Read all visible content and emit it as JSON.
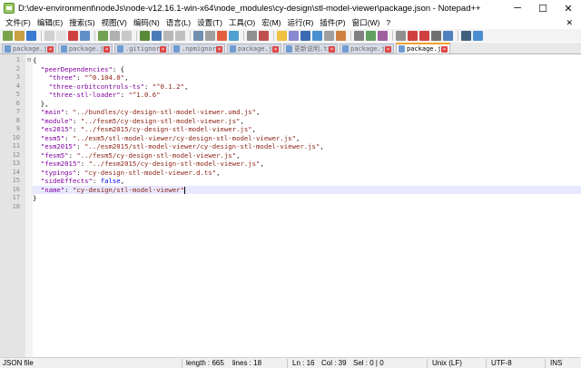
{
  "window": {
    "title": "D:\\dev-environment\\nodeJs\\node-v12.16.1-win-x64\\node_modules\\cy-design\\stl-model-viewer\\package.json - Notepad++",
    "minimize": "─",
    "maximize": "☐",
    "close": "✕"
  },
  "menu": [
    "文件(F)",
    "编辑(E)",
    "搜索(S)",
    "视图(V)",
    "编码(N)",
    "语言(L)",
    "设置(T)",
    "工具(O)",
    "宏(M)",
    "运行(R)",
    "插件(P)",
    "窗口(W)",
    "?"
  ],
  "menu_close": "✕",
  "toolbar": {
    "colors": [
      "#7ba44a",
      "#c9a042",
      "#3a7ad0",
      "#d0d0d0",
      "#e2e2e2",
      "#d04040",
      "#6090c8",
      "#70a050",
      "#b0b0b0",
      "#c8c8c8",
      "#5a8a3a",
      "#4a7ab8",
      "#b8b8b8",
      "#c0c0c0",
      "#7090b0",
      "#a0a0a0",
      "#e06040",
      "#50a0d0",
      "#909090",
      "#c05050",
      "#f0c040",
      "#8888d0",
      "#3a6ab0",
      "#4a90d0",
      "#a0a0a0",
      "#d08040",
      "#808080",
      "#60a060",
      "#a060a0",
      "#909090",
      "#d04040",
      "#d04040",
      "#707070",
      "#5080c0",
      "#406080",
      "#4a90d0"
    ],
    "groups": [
      3,
      4,
      3,
      4,
      4,
      2,
      6,
      3,
      5,
      2
    ]
  },
  "tabs": [
    {
      "label": "package.json",
      "active": false
    },
    {
      "label": "package.json",
      "active": false
    },
    {
      "label": ".gitignore",
      "active": false
    },
    {
      "label": ".npmignore",
      "active": false
    },
    {
      "label": "package.json",
      "active": false
    },
    {
      "label": "更新说明.txt",
      "active": false
    },
    {
      "label": "package.json",
      "active": false
    },
    {
      "label": "package.json",
      "active": true
    }
  ],
  "editor": {
    "current_line": 16,
    "lines": [
      {
        "n": "1",
        "fold": "⊟",
        "tokens": [
          {
            "t": "{",
            "c": "p"
          }
        ]
      },
      {
        "n": "2",
        "fold": "",
        "tokens": [
          {
            "t": "  ",
            "c": "p"
          },
          {
            "t": "\"peerDependencies\"",
            "c": "k"
          },
          {
            "t": ": {",
            "c": "p"
          }
        ]
      },
      {
        "n": "3",
        "fold": "",
        "tokens": [
          {
            "t": "    ",
            "c": "p"
          },
          {
            "t": "\"three\"",
            "c": "k"
          },
          {
            "t": ": ",
            "c": "p"
          },
          {
            "t": "\"^0.104.0\"",
            "c": "s"
          },
          {
            "t": ",",
            "c": "p"
          }
        ]
      },
      {
        "n": "4",
        "fold": "",
        "tokens": [
          {
            "t": "    ",
            "c": "p"
          },
          {
            "t": "\"three-orbitcontrols-ts\"",
            "c": "k"
          },
          {
            "t": ": ",
            "c": "p"
          },
          {
            "t": "\"^0.1.2\"",
            "c": "s"
          },
          {
            "t": ",",
            "c": "p"
          }
        ]
      },
      {
        "n": "5",
        "fold": "",
        "tokens": [
          {
            "t": "    ",
            "c": "p"
          },
          {
            "t": "\"three-stl-loader\"",
            "c": "k"
          },
          {
            "t": ": ",
            "c": "p"
          },
          {
            "t": "\"^1.0.6\"",
            "c": "s"
          }
        ]
      },
      {
        "n": "6",
        "fold": "",
        "tokens": [
          {
            "t": "  },",
            "c": "p"
          }
        ]
      },
      {
        "n": "7",
        "fold": "",
        "tokens": [
          {
            "t": "  ",
            "c": "p"
          },
          {
            "t": "\"main\"",
            "c": "k"
          },
          {
            "t": ": ",
            "c": "p"
          },
          {
            "t": "\"../bundles/cy-design-stl-model-viewer.umd.js\"",
            "c": "s"
          },
          {
            "t": ",",
            "c": "p"
          }
        ]
      },
      {
        "n": "8",
        "fold": "",
        "tokens": [
          {
            "t": "  ",
            "c": "p"
          },
          {
            "t": "\"module\"",
            "c": "k"
          },
          {
            "t": ": ",
            "c": "p"
          },
          {
            "t": "\"../fesm5/cy-design-stl-model-viewer.js\"",
            "c": "s"
          },
          {
            "t": ",",
            "c": "p"
          }
        ]
      },
      {
        "n": "9",
        "fold": "",
        "tokens": [
          {
            "t": "  ",
            "c": "p"
          },
          {
            "t": "\"es2015\"",
            "c": "k"
          },
          {
            "t": ": ",
            "c": "p"
          },
          {
            "t": "\"../fesm2015/cy-design-stl-model-viewer.js\"",
            "c": "s"
          },
          {
            "t": ",",
            "c": "p"
          }
        ]
      },
      {
        "n": "10",
        "fold": "",
        "tokens": [
          {
            "t": "  ",
            "c": "p"
          },
          {
            "t": "\"esm5\"",
            "c": "k"
          },
          {
            "t": ": ",
            "c": "p"
          },
          {
            "t": "\"../esm5/stl-model-viewer/cy-design-stl-model-viewer.js\"",
            "c": "s"
          },
          {
            "t": ",",
            "c": "p"
          }
        ]
      },
      {
        "n": "11",
        "fold": "",
        "tokens": [
          {
            "t": "  ",
            "c": "p"
          },
          {
            "t": "\"esm2015\"",
            "c": "k"
          },
          {
            "t": ": ",
            "c": "p"
          },
          {
            "t": "\"../esm2015/stl-model-viewer/cy-design-stl-model-viewer.js\"",
            "c": "s"
          },
          {
            "t": ",",
            "c": "p"
          }
        ]
      },
      {
        "n": "12",
        "fold": "",
        "tokens": [
          {
            "t": "  ",
            "c": "p"
          },
          {
            "t": "\"fesm5\"",
            "c": "k"
          },
          {
            "t": ": ",
            "c": "p"
          },
          {
            "t": "\"../fesm5/cy-design-stl-model-viewer.js\"",
            "c": "s"
          },
          {
            "t": ",",
            "c": "p"
          }
        ]
      },
      {
        "n": "13",
        "fold": "",
        "tokens": [
          {
            "t": "  ",
            "c": "p"
          },
          {
            "t": "\"fesm2015\"",
            "c": "k"
          },
          {
            "t": ": ",
            "c": "p"
          },
          {
            "t": "\"../fesm2015/cy-design-stl-model-viewer.js\"",
            "c": "s"
          },
          {
            "t": ",",
            "c": "p"
          }
        ]
      },
      {
        "n": "14",
        "fold": "",
        "tokens": [
          {
            "t": "  ",
            "c": "p"
          },
          {
            "t": "\"typings\"",
            "c": "k"
          },
          {
            "t": ": ",
            "c": "p"
          },
          {
            "t": "\"cy-design-stl-model-viewer.d.ts\"",
            "c": "s"
          },
          {
            "t": ",",
            "c": "p"
          }
        ]
      },
      {
        "n": "15",
        "fold": "",
        "tokens": [
          {
            "t": "  ",
            "c": "p"
          },
          {
            "t": "\"sideEffects\"",
            "c": "k"
          },
          {
            "t": ": ",
            "c": "p"
          },
          {
            "t": "false",
            "c": "b"
          },
          {
            "t": ",",
            "c": "p"
          }
        ]
      },
      {
        "n": "16",
        "fold": "",
        "tokens": [
          {
            "t": "  ",
            "c": "p"
          },
          {
            "t": "\"name\"",
            "c": "k"
          },
          {
            "t": ": ",
            "c": "p"
          },
          {
            "t": "\"cy-design/stl-model-viewer\"",
            "c": "s"
          }
        ]
      },
      {
        "n": "17",
        "fold": "",
        "tokens": [
          {
            "t": "}",
            "c": "p"
          }
        ]
      },
      {
        "n": "18",
        "fold": "",
        "tokens": []
      }
    ]
  },
  "status": {
    "file_type": "JSON file",
    "length": "length : 665",
    "lines": "lines : 18",
    "ln": "Ln : 16",
    "col": "Col : 39",
    "sel": "Sel : 0 | 0",
    "eol": "Unix (LF)",
    "encoding": "UTF-8",
    "mode": "INS"
  }
}
